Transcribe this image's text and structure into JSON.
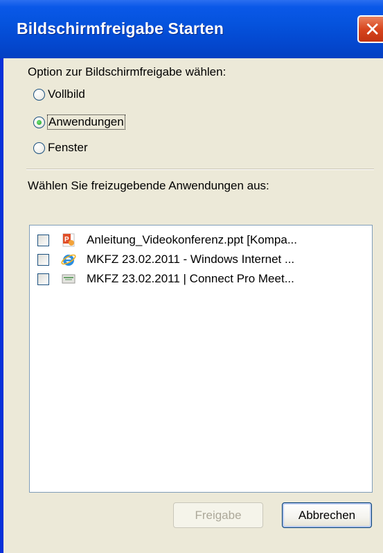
{
  "window": {
    "title": "Bildschirmfreigabe Starten",
    "close_glyph": "✕"
  },
  "options": {
    "prompt": "Option zur Bildschirmfreigabe wählen:",
    "items": [
      {
        "label": "Vollbild",
        "selected": false
      },
      {
        "label": "Anwendungen",
        "selected": true
      },
      {
        "label": "Fenster",
        "selected": false
      }
    ]
  },
  "apps": {
    "prompt": "Wählen Sie freizugebende Anwendungen aus:",
    "items": [
      {
        "label": "Anleitung_Videokonferenz.ppt [Kompa...",
        "icon": "powerpoint-icon",
        "checked": false
      },
      {
        "label": "MKFZ 23.02.2011 - Windows Internet ...",
        "icon": "internet-explorer-icon",
        "checked": false
      },
      {
        "label": "MKFZ 23.02.2011 | Connect Pro Meet...",
        "icon": "connect-pro-icon",
        "checked": false
      }
    ]
  },
  "buttons": {
    "share": "Freigabe",
    "cancel": "Abbrechen"
  },
  "colors": {
    "titlebar": "#0553dd",
    "client": "#ece9d8",
    "close": "#d8461e"
  }
}
